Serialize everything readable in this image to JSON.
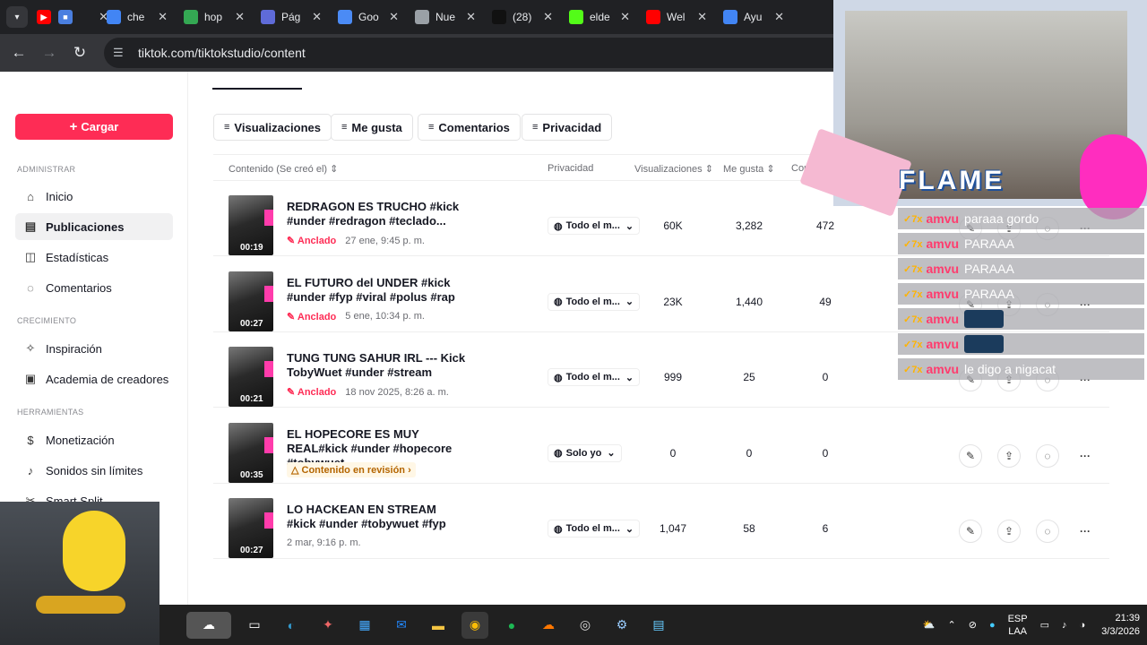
{
  "browser": {
    "tabs": [
      {
        "label": "che",
        "icon": "google-icon",
        "color": "#4285f4"
      },
      {
        "label": "hop",
        "icon": "drive-icon",
        "color": "#34a853"
      },
      {
        "label": "Pág",
        "icon": "globe-icon",
        "color": "#5f6bd8"
      },
      {
        "label": "Goo",
        "icon": "gemini-icon",
        "color": "#4b8bf5"
      },
      {
        "label": "Nue",
        "icon": "chatgpt-icon",
        "color": "#9aa0a6"
      },
      {
        "label": "(28)",
        "icon": "tiktok-icon",
        "color": "#111111"
      },
      {
        "label": "elde",
        "icon": "kick-icon",
        "color": "#53fc18"
      },
      {
        "label": "Wel",
        "icon": "youtube-icon",
        "color": "#ff0000"
      },
      {
        "label": "Ayu",
        "icon": "google-icon",
        "color": "#4285f4"
      }
    ],
    "url": "tiktok.com/tiktokstudio/content"
  },
  "sidebar": {
    "upload_label": "Cargar",
    "sections": {
      "admin": "ADMINISTRAR",
      "growth": "CRECIMIENTO",
      "tools": "HERRAMIENTAS"
    },
    "items": [
      {
        "label": "Inicio",
        "icon": "home-icon"
      },
      {
        "label": "Publicaciones",
        "icon": "posts-icon",
        "active": true
      },
      {
        "label": "Estadísticas",
        "icon": "analytics-icon"
      },
      {
        "label": "Comentarios",
        "icon": "comments-icon"
      },
      {
        "label": "Inspiración",
        "icon": "lightbulb-icon"
      },
      {
        "label": "Academia de creadores",
        "icon": "academy-icon"
      },
      {
        "label": "Monetización",
        "icon": "money-icon"
      },
      {
        "label": "Sonidos sin límites",
        "icon": "music-icon"
      },
      {
        "label": "Smart Split",
        "icon": "scissors-icon"
      }
    ]
  },
  "filters": [
    "Visualizaciones",
    "Me gusta",
    "Comentarios",
    "Privacidad"
  ],
  "table": {
    "columns": {
      "content": "Contenido (Se creó el)",
      "privacy": "Privacidad",
      "views": "Visualizaciones",
      "likes": "Me gusta",
      "comments": "Come"
    },
    "rows": [
      {
        "title": "REDRAGON ES TRUCHO #kick #under #redragon #teclado...",
        "duration": "00:19",
        "tag": "Anclado",
        "tag_type": "pinned",
        "date": "27 ene, 9:45 p. m.",
        "privacy": "Todo el m...",
        "views": "60K",
        "likes": "3,282",
        "comments": "472"
      },
      {
        "title": "EL FUTURO del UNDER #kick #under #fyp #viral #polus #rap",
        "duration": "00:27",
        "tag": "Anclado",
        "tag_type": "pinned",
        "date": "5 ene, 10:34 p. m.",
        "privacy": "Todo el m...",
        "views": "23K",
        "likes": "1,440",
        "comments": "49"
      },
      {
        "title": "TUNG TUNG SAHUR IRL --- Kick TobyWuet #under #stream",
        "duration": "00:21",
        "tag": "Anclado",
        "tag_type": "pinned",
        "date": "18 nov 2025, 8:26 a. m.",
        "privacy": "Todo el m...",
        "views": "999",
        "likes": "25",
        "comments": "0"
      },
      {
        "title": "EL HOPECORE ES MUY REAL#kick #under #hopecore #tobywuet...",
        "duration": "00:35",
        "tag": "Contenido en revisión ›",
        "tag_type": "review",
        "date": "",
        "privacy": "Solo yo",
        "views": "0",
        "likes": "0",
        "comments": "0"
      },
      {
        "title": "LO HACKEAN EN STREAM #kick #under #tobywuet #fyp",
        "duration": "00:27",
        "tag": "",
        "tag_type": "none",
        "date": "2 mar, 9:16 p. m.",
        "privacy": "Todo el m...",
        "views": "1,047",
        "likes": "58",
        "comments": "6"
      }
    ]
  },
  "stream_overlay": {
    "banner": "FLAME",
    "chat": [
      {
        "user": "amvu",
        "text": "paraaa gordo"
      },
      {
        "user": "amvu",
        "text": "PARAAA"
      },
      {
        "user": "amvu",
        "text": "PARAAA"
      },
      {
        "user": "amvu",
        "text": "PARAAA"
      },
      {
        "user": "amvu",
        "text": "",
        "emote": true
      },
      {
        "user": "amvu",
        "text": "",
        "emote": true
      },
      {
        "user": "amvu",
        "text": "le digo a nigacat"
      }
    ]
  },
  "taskbar": {
    "lang": "ESP",
    "layout": "LAA",
    "time": "21:39",
    "date": "3/3/2026"
  }
}
